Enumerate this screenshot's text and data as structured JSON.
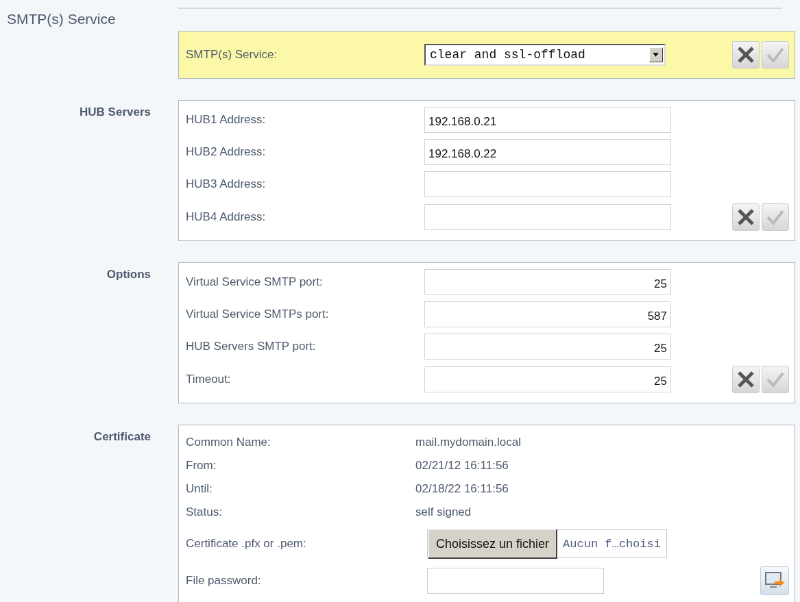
{
  "page_title": "SMTP(s) Service",
  "service": {
    "label": "SMTP(s) Service:",
    "value": "clear and ssl-offload"
  },
  "hub_servers": {
    "heading": "HUB Servers",
    "fields": [
      {
        "label": "HUB1 Address:",
        "value": "192.168.0.21",
        "kind": "text"
      },
      {
        "label": "HUB2 Address:",
        "value": "192.168.0.22",
        "kind": "text"
      },
      {
        "label": "HUB3 Address:",
        "kind": "text"
      },
      {
        "label": "HUB4 Address:",
        "kind": "text"
      }
    ]
  },
  "options": {
    "heading": "Options",
    "fields": [
      {
        "label": "Virtual Service SMTP port:",
        "value": "25",
        "kind": "number"
      },
      {
        "label": "Virtual Service SMTPs port:",
        "value": "587",
        "kind": "number"
      },
      {
        "label": "HUB Servers SMTP port:",
        "value": "25",
        "kind": "number"
      },
      {
        "label": "Timeout:",
        "value": "25",
        "kind": "number"
      }
    ]
  },
  "certificate": {
    "heading": "Certificate",
    "details": [
      {
        "label": "Common Name:",
        "value": "mail.mydomain.local"
      },
      {
        "label": "From:",
        "value": "02/21/12 16:11:56"
      },
      {
        "label": "Until:",
        "value": "02/18/22 16:11:56"
      },
      {
        "label": "Status:",
        "value": "self signed"
      }
    ],
    "file": {
      "label": "Certificate .pfx or .pem:",
      "button": "Choisissez un fichier",
      "status": "Aucun f…choisi"
    },
    "password": {
      "label": "File password:"
    }
  }
}
